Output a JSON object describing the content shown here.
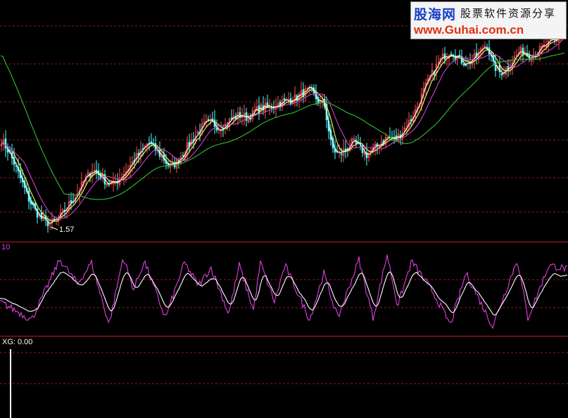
{
  "watermark": {
    "name": "股海网",
    "slogan": "股票软件资源分享",
    "url": "www.Guhai.com.cn"
  },
  "colors": {
    "background": "#000000",
    "grid": "#8c1a1a",
    "divider": "#b81c1c",
    "up_candle": "#ff5050",
    "down_candle": "#50ffff",
    "ma_short": "#ffffff",
    "ma_mid": "#ffff60",
    "ma_long": "#d040d0",
    "ma_longest": "#30c030",
    "osc_fast": "#e040e0",
    "osc_slow": "#ffffff",
    "xg_bar": "#ffffff",
    "label_xg": "#ffffff",
    "label_osc": "#e040e0"
  },
  "chart_data": [
    {
      "type": "candlestick",
      "panel": "price",
      "annotation": {
        "text": "1.57",
        "note": "lowest price marker"
      },
      "series": [
        {
          "name": "",
          "role": "close_trend",
          "x": [
            0,
            10,
            20,
            30,
            40,
            50,
            60,
            70,
            80,
            90,
            100,
            110,
            120,
            130,
            140,
            150,
            160,
            170,
            180,
            190,
            200,
            210,
            220,
            230,
            240,
            250,
            260,
            270,
            280,
            290,
            300,
            310,
            320,
            330,
            340,
            350,
            360,
            370,
            380,
            390,
            400,
            410,
            420,
            430,
            440,
            450,
            460,
            470,
            480,
            490,
            500,
            510,
            520,
            530,
            540,
            550,
            560,
            570,
            580,
            590,
            600,
            610,
            620,
            630,
            640,
            650,
            660,
            670,
            680,
            690,
            700,
            710,
            720,
            730,
            740,
            750,
            760,
            770,
            780,
            790,
            800
          ],
          "values": [
            5.0,
            4.6,
            4.0,
            3.3,
            2.6,
            2.1,
            1.75,
            1.6,
            1.75,
            2.1,
            2.5,
            2.9,
            3.4,
            3.8,
            3.6,
            3.3,
            3.2,
            3.5,
            3.8,
            4.2,
            4.5,
            4.9,
            4.6,
            4.3,
            3.9,
            4.1,
            4.5,
            4.9,
            5.3,
            5.6,
            5.7,
            5.5,
            5.6,
            5.9,
            6.0,
            5.9,
            6.1,
            6.3,
            6.3,
            6.4,
            6.5,
            6.6,
            6.7,
            6.9,
            7.0,
            6.6,
            6.4,
            4.7,
            4.4,
            4.6,
            4.9,
            4.7,
            4.4,
            4.6,
            4.9,
            5.1,
            5.0,
            5.3,
            5.7,
            6.2,
            6.9,
            7.5,
            8.0,
            8.4,
            8.6,
            8.3,
            8.1,
            8.2,
            8.5,
            8.9,
            8.0,
            7.7,
            7.9,
            8.3,
            8.6,
            8.4,
            8.5,
            8.7,
            8.9,
            9.0,
            9.6
          ]
        },
        {
          "name": "",
          "role": "ma_5"
        },
        {
          "name": "",
          "role": "ma_10"
        },
        {
          "name": "",
          "role": "ma_20"
        },
        {
          "name": "",
          "role": "ma_60"
        }
      ],
      "ylim": [
        1.0,
        10.5
      ]
    },
    {
      "type": "line",
      "panel": "oscillator",
      "label": "10",
      "ylim": [
        0,
        100
      ],
      "cycles": [
        {
          "x": 0,
          "value": 40
        },
        {
          "x": 45,
          "value": 18
        },
        {
          "x": 85,
          "value": 92
        },
        {
          "x": 110,
          "value": 62
        },
        {
          "x": 130,
          "value": 88
        },
        {
          "x": 155,
          "value": 12
        },
        {
          "x": 175,
          "value": 95
        },
        {
          "x": 190,
          "value": 55
        },
        {
          "x": 205,
          "value": 90
        },
        {
          "x": 235,
          "value": 20
        },
        {
          "x": 262,
          "value": 88
        },
        {
          "x": 282,
          "value": 60
        },
        {
          "x": 300,
          "value": 82
        },
        {
          "x": 325,
          "value": 25
        },
        {
          "x": 340,
          "value": 85
        },
        {
          "x": 360,
          "value": 30
        },
        {
          "x": 370,
          "value": 88
        },
        {
          "x": 390,
          "value": 40
        },
        {
          "x": 405,
          "value": 85
        },
        {
          "x": 440,
          "value": 18
        },
        {
          "x": 460,
          "value": 75
        },
        {
          "x": 480,
          "value": 20
        },
        {
          "x": 510,
          "value": 92
        },
        {
          "x": 530,
          "value": 20
        },
        {
          "x": 550,
          "value": 98
        },
        {
          "x": 565,
          "value": 35
        },
        {
          "x": 585,
          "value": 90
        },
        {
          "x": 615,
          "value": 52
        },
        {
          "x": 640,
          "value": 12
        },
        {
          "x": 662,
          "value": 75
        },
        {
          "x": 700,
          "value": 10
        },
        {
          "x": 735,
          "value": 92
        },
        {
          "x": 750,
          "value": 20
        },
        {
          "x": 780,
          "value": 85
        },
        {
          "x": 807,
          "value": 80
        }
      ],
      "series": [
        {
          "name": "",
          "role": "fast"
        },
        {
          "name": "",
          "role": "slow"
        }
      ]
    },
    {
      "type": "bar",
      "panel": "signal",
      "label": "XG: 0.00",
      "bars": [
        {
          "x": 15,
          "value": 1
        }
      ],
      "ylim": [
        0,
        1
      ]
    }
  ]
}
